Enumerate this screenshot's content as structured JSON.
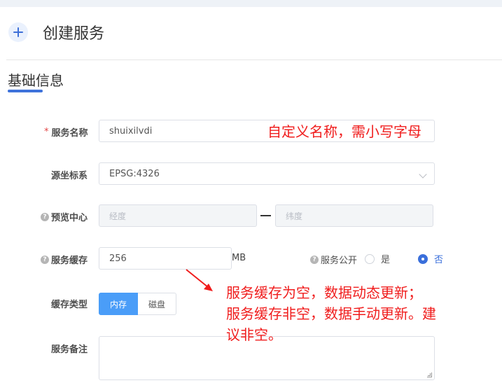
{
  "header": {
    "title": "创建服务"
  },
  "section": {
    "title": "基础信息"
  },
  "form": {
    "name": {
      "required_mark": "*",
      "label": "服务名称",
      "value": "shuixilvdi"
    },
    "crs": {
      "label": "源坐标系",
      "value": "EPSG:4326"
    },
    "preview_center": {
      "help_mark": "?",
      "label": "预览中心",
      "lon_placeholder": "经度",
      "lat_placeholder": "纬度"
    },
    "cache": {
      "help_mark": "?",
      "label": "服务缓存",
      "value": "256",
      "unit": "MB"
    },
    "public": {
      "help_mark": "?",
      "label": "服务公开",
      "options": [
        "是",
        "否"
      ],
      "selected": "否"
    },
    "cache_type": {
      "label": "缓存类型",
      "options": [
        "内存",
        "磁盘"
      ],
      "selected": "内存"
    },
    "remark": {
      "label": "服务备注",
      "value": ""
    }
  },
  "annotations": {
    "name_note": "自定义名称，需小写字母",
    "cache_note_lines": [
      "服务缓存为空，数据动态更新；",
      "服务缓存非空，数据手动更新。建",
      "议非空。"
    ]
  },
  "colors": {
    "accent": "#3a6fdb",
    "segment_active": "#4a9df8",
    "annotation": "#f01d1d",
    "required": "#e34646"
  },
  "icons": [
    "plus-icon",
    "help-icon",
    "chevron-down-icon",
    "arrow-icon"
  ]
}
